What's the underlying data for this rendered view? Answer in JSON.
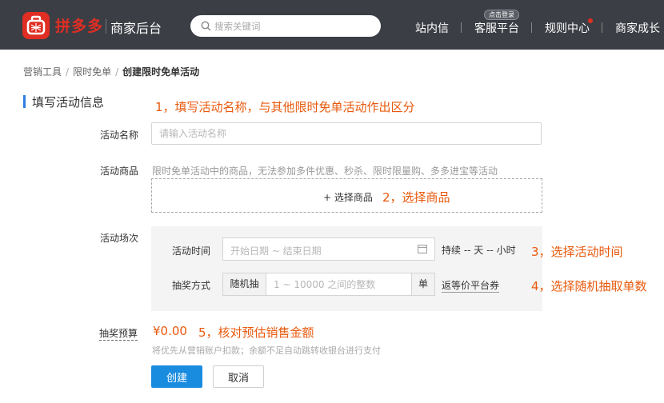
{
  "header": {
    "logo_text": "拼多多",
    "logo_sub": "商家后台",
    "search_placeholder": "搜索关键词",
    "nav": {
      "messages": "站内信",
      "service": "客服平台",
      "service_badge": "点击登录",
      "rules": "规则中心",
      "growth": "商家成长"
    }
  },
  "breadcrumb": {
    "level1": "营销工具",
    "level2": "限时免单",
    "current": "创建限时免单活动",
    "separator": "/"
  },
  "section_title": "填写活动信息",
  "annotations": {
    "a1": "1，填写活动名称，与其他限时免单活动作出区分",
    "a2": "2，选择商品",
    "a3": "3，选择活动时间",
    "a4": "4，选择随机抽取单数",
    "a5": "5，核对预估销售金额"
  },
  "form": {
    "name_label": "活动名称",
    "name_placeholder": "请输入活动名称",
    "product_label": "活动商品",
    "product_hint": "限时免单活动中的商品，无法参加多件优惠、秒杀、限时限量购、多多进宝等活动",
    "product_select": "+ 选择商品",
    "session_label": "活动场次",
    "time_label": "活动时间",
    "time_placeholder": "开始日期 ~ 结束日期",
    "duration": "持续 -- 天 -- 小时",
    "lottery_label": "抽奖方式",
    "lottery_prefix": "随机抽",
    "lottery_placeholder": "1 ~ 10000 之间的整数",
    "lottery_suffix": "单",
    "coupon_link": "返等价平台券",
    "budget_label": "抽奖预算",
    "budget_value": "¥0.00",
    "budget_note": "将优先从营销账户扣款；余额不足自动跳转收银台进行支付"
  },
  "buttons": {
    "create": "创建",
    "cancel": "取消"
  },
  "colors": {
    "header_bg": "#3b3e44",
    "brand_red": "#e02e24",
    "annotation_orange": "#e8590c",
    "primary_blue": "#1a8ce0",
    "section_bar_blue": "#2f7ee0"
  }
}
